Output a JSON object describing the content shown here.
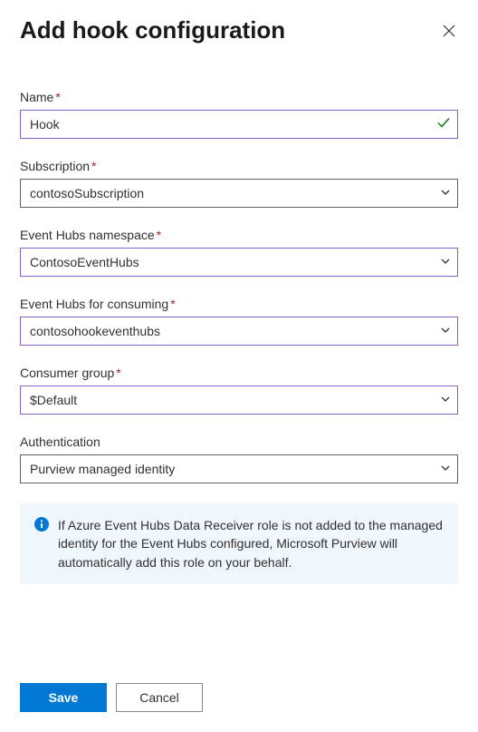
{
  "header": {
    "title": "Add hook configuration"
  },
  "fields": {
    "name": {
      "label": "Name",
      "value": "Hook",
      "required": true
    },
    "subscription": {
      "label": "Subscription",
      "value": "contosoSubscription",
      "required": true
    },
    "eventHubsNamespace": {
      "label": "Event Hubs namespace",
      "value": "ContosoEventHubs",
      "required": true
    },
    "eventHubsForConsuming": {
      "label": "Event Hubs for consuming",
      "value": "contosohookeventhubs",
      "required": true
    },
    "consumerGroup": {
      "label": "Consumer group",
      "value": "$Default",
      "required": true
    },
    "authentication": {
      "label": "Authentication",
      "value": "Purview managed identity",
      "required": false
    }
  },
  "info": {
    "text": "If Azure Event Hubs Data Receiver role is not added to the managed identity for the Event Hubs configured, Microsoft Purview will automatically add this role on your behalf."
  },
  "footer": {
    "save": "Save",
    "cancel": "Cancel"
  }
}
